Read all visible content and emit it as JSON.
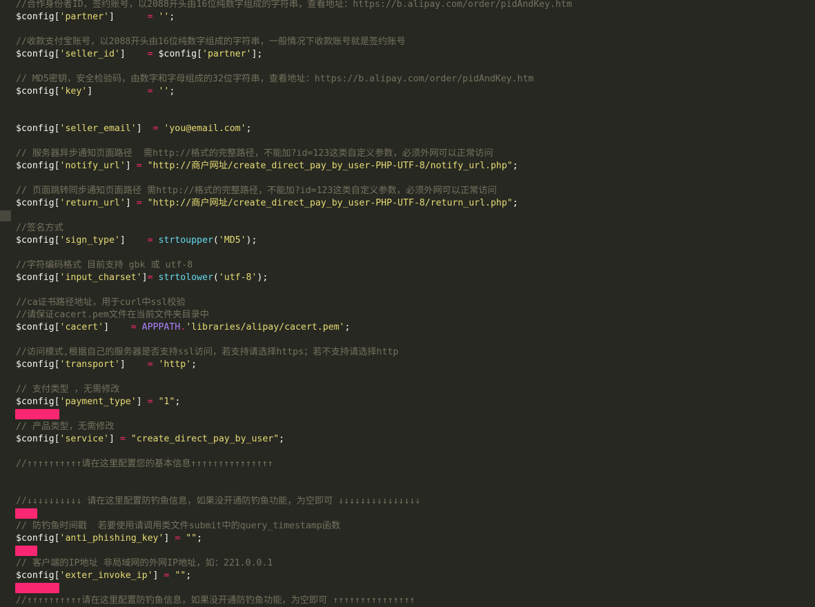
{
  "colors": {
    "background": "#272822",
    "comment": "#75715e",
    "variable": "#f8f8f2",
    "string": "#e6db74",
    "operator": "#f92672",
    "function": "#66d9ef",
    "constant": "#ae81ff",
    "error_marker": "#f92672"
  },
  "code": {
    "l01": {
      "c": "//合作身份者ID，签约账号，以2088开头由16位纯数字组成的字符串，查看地址：https://b.alipay.com/order/pidAndKey.htm"
    },
    "l02": {
      "a": "$config[",
      "b": "'partner'",
      "c": "]      ",
      "d": "=",
      "e": " ",
      "f": "''",
      "g": ";"
    },
    "l04": {
      "c": "//收款支付宝账号，以2088开头由16位纯数字组成的字符串，一般情况下收款账号就是签约账号"
    },
    "l05": {
      "a": "$config[",
      "b": "'seller_id'",
      "c": "]    ",
      "d": "=",
      "e": " $config[",
      "f": "'partner'",
      "g": "];"
    },
    "l07": {
      "c": "// MD5密钥，安全检验码，由数字和字母组成的32位字符串，查看地址：https://b.alipay.com/order/pidAndKey.htm"
    },
    "l08": {
      "a": "$config[",
      "b": "'key'",
      "c": "]          ",
      "d": "=",
      "e": " ",
      "f": "''",
      "g": ";"
    },
    "l11": {
      "a": "$config[",
      "b": "'seller_email'",
      "c": "]  ",
      "d": "=",
      "e": " ",
      "f": "'you@email.com'",
      "g": ";"
    },
    "l13": {
      "c": "// 服务器异步通知页面路径  需http://格式的完整路径，不能加?id=123这类自定义参数，必须外网可以正常访问"
    },
    "l14": {
      "a": "$config[",
      "b": "'notify_url'",
      "c": "] ",
      "d": "=",
      "e": " ",
      "f": "\"http://商户网址/create_direct_pay_by_user-PHP-UTF-8/notify_url.php\"",
      "g": ";"
    },
    "l16": {
      "c": "// 页面跳转同步通知页面路径 需http://格式的完整路径，不能加?id=123这类自定义参数，必须外网可以正常访问"
    },
    "l17": {
      "a": "$config[",
      "b": "'return_url'",
      "c": "] ",
      "d": "=",
      "e": " ",
      "f": "\"http://商户网址/create_direct_pay_by_user-PHP-UTF-8/return_url.php\"",
      "g": ";"
    },
    "l19": {
      "c": "//签名方式"
    },
    "l20": {
      "a": "$config[",
      "b": "'sign_type'",
      "c": "]    ",
      "d": "=",
      "e": " ",
      "fn": "strtoupper",
      "p1": "(",
      "f": "'MD5'",
      "g": ");"
    },
    "l22": {
      "c": "//字符编码格式 目前支持 gbk 或 utf-8"
    },
    "l23": {
      "a": "$config[",
      "b": "'input_charset'",
      "c": "]",
      "d": "=",
      "e": " ",
      "fn": "strtolower",
      "p1": "(",
      "f": "'utf-8'",
      "g": ");"
    },
    "l25": {
      "c": "//ca证书路径地址，用于curl中ssl校验"
    },
    "l26": {
      "c": "//请保证cacert.pem文件在当前文件夹目录中"
    },
    "l27": {
      "a": "$config[",
      "b": "'cacert'",
      "c": "]    ",
      "d": "=",
      "e": " ",
      "k": "APPPATH",
      "dot": ".",
      "f": "'libraries/alipay/cacert.pem'",
      "g": ";"
    },
    "l29": {
      "c": "//访问模式,根据自己的服务器是否支持ssl访问，若支持请选择https；若不支持请选择http"
    },
    "l30": {
      "a": "$config[",
      "b": "'transport'",
      "c": "]    ",
      "d": "=",
      "e": " ",
      "f": "'http'",
      "g": ";"
    },
    "l32": {
      "c": "// 支付类型 ，无需修改"
    },
    "l33": {
      "a": "$config[",
      "b": "'payment_type'",
      "c": "] ",
      "d": "=",
      "e": " ",
      "f": "\"1\"",
      "g": ";"
    },
    "l35": {
      "c": "// 产品类型，无需修改"
    },
    "l36": {
      "a": "$config[",
      "b": "'service'",
      "c": "] ",
      "d": "=",
      "e": " ",
      "f": "\"create_direct_pay_by_user\"",
      "g": ";"
    },
    "l38": {
      "c": "//↑↑↑↑↑↑↑↑↑↑请在这里配置您的基本信息↑↑↑↑↑↑↑↑↑↑↑↑↑↑↑"
    },
    "l41": {
      "c": "//↓↓↓↓↓↓↓↓↓↓ 请在这里配置防钓鱼信息，如果没开通防钓鱼功能，为空即可 ↓↓↓↓↓↓↓↓↓↓↓↓↓↓↓"
    },
    "l43": {
      "c": "// 防钓鱼时间戳  若要使用请调用类文件submit中的query_timestamp函数"
    },
    "l44": {
      "a": "$config[",
      "b": "'anti_phishing_key'",
      "c": "] ",
      "d": "=",
      "e": " ",
      "f": "\"\"",
      "g": ";"
    },
    "l46": {
      "c": "// 客户端的IP地址 非局域网的外网IP地址，如：221.0.0.1"
    },
    "l47": {
      "a": "$config[",
      "b": "'exter_invoke_ip'",
      "c": "] ",
      "d": "=",
      "e": " ",
      "f": "\"\"",
      "g": ";"
    },
    "l49": {
      "c": "//↑↑↑↑↑↑↑↑↑↑请在这里配置防钓鱼信息，如果没开通防钓鱼功能，为空即可 ↑↑↑↑↑↑↑↑↑↑↑↑↑↑↑"
    }
  }
}
